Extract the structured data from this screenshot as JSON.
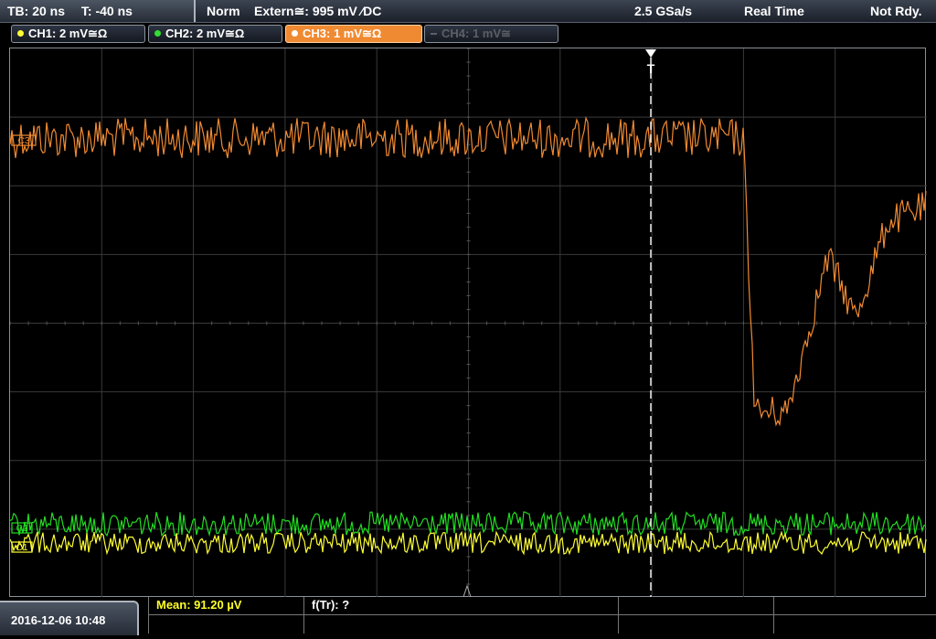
{
  "topbar": {
    "timebase": "TB: 20 ns",
    "trigger_time": "T: -40 ns",
    "trigger_mode": "Norm",
    "trigger_source": "Extern≅: 995 mV ⁄DC",
    "sample_rate": "2.5 GSa/s",
    "acq_mode": "Real Time",
    "acq_state": "Not Rdy."
  },
  "channels": [
    {
      "label": "CH1: 2 mV≅Ω",
      "color": "#ffff33",
      "active": true
    },
    {
      "label": "CH2: 2 mV≅Ω",
      "color": "#33dd33",
      "active": true
    },
    {
      "label": "CH3: 1 mV≅Ω",
      "color": "#f08a32",
      "active": true,
      "selected": true
    },
    {
      "label": "CH4: 1 mV≅",
      "color": "#5b6066",
      "active": false
    }
  ],
  "plot": {
    "trigger_marker": "T",
    "markers": {
      "ch1": "C1",
      "ch2": "C2",
      "ch3": "C3"
    },
    "colors": {
      "ch1": "#ffff33",
      "ch2": "#22dd22",
      "ch3": "#f08a32",
      "grid": "#3a3a3a"
    }
  },
  "bottombar": {
    "datetime": "2016-12-06 10:48",
    "measurements": [
      {
        "label": "Mean: 91.20 µV",
        "color": "#ffff2a"
      },
      {
        "label": "f(Tr): ?",
        "color": "#ffffff"
      }
    ]
  }
}
